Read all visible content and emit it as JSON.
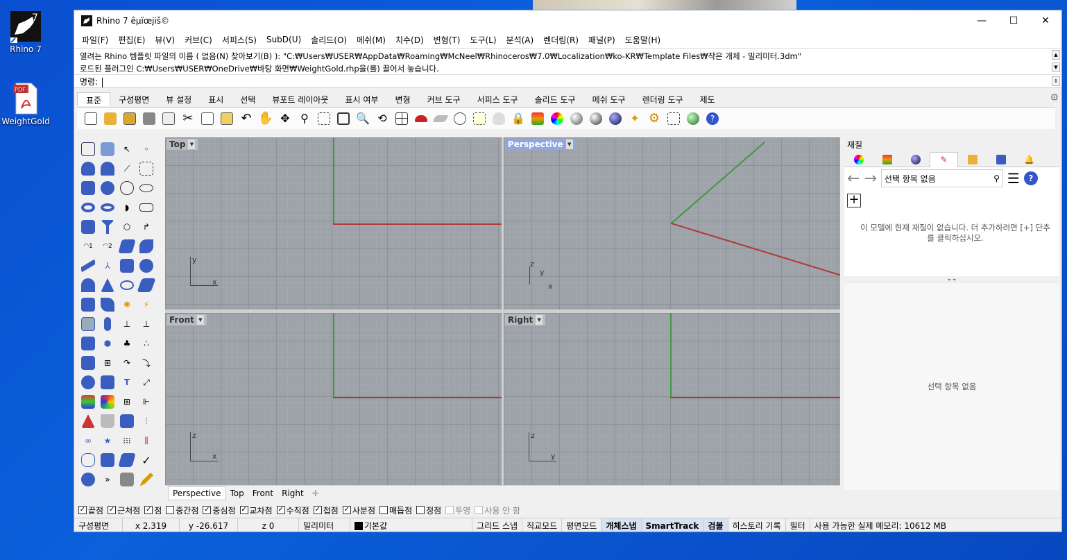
{
  "desktop": {
    "icons": [
      {
        "label": "Rhino 7"
      },
      {
        "label": "WeightGold"
      }
    ]
  },
  "window": {
    "title": "Rhino 7 êµïœjiš©",
    "controls": {
      "minimize": "—",
      "maximize": "☐",
      "close": "✕"
    }
  },
  "menubar": {
    "items": [
      "파일(F)",
      "편집(E)",
      "뷰(V)",
      "커브(C)",
      "서피스(S)",
      "SubD(U)",
      "솔리드(O)",
      "메쉬(M)",
      "치수(D)",
      "변형(T)",
      "도구(L)",
      "분석(A)",
      "렌더링(R)",
      "패널(P)",
      "도움말(H)"
    ]
  },
  "command": {
    "history": [
      "열려는 Rhino 템플릿 파일의 이름 ( 없음(N)  찾아보기(B) ): \"C:₩Users₩USER₩AppData₩Roaming₩McNeel₩Rhinoceros₩7.0₩Localization₩ko-KR₩Template Files₩작은 개체 - 밀리미터.3dm\"",
      "로드된 플러그인 C:₩Users₩USER₩OneDrive₩바탕 화면₩WeightGold.rhp을(를) 끌어서 놓습니다."
    ],
    "prompt": "명령:",
    "value": ""
  },
  "toolbar_tabs": [
    "표준",
    "구성평면",
    "뷰 설정",
    "표시",
    "선택",
    "뷰포트 레이아웃",
    "표시 여부",
    "변형",
    "커브 도구",
    "서피스 도구",
    "솔리드 도구",
    "메쉬 도구",
    "렌더링 도구",
    "제도"
  ],
  "viewports": {
    "top": {
      "label": "Top",
      "axis1": "y",
      "axis2": "x"
    },
    "perspective": {
      "label": "Perspective",
      "axis_z": "z",
      "axis_y": "y",
      "axis_x": "x"
    },
    "front": {
      "label": "Front",
      "axis1": "z",
      "axis2": "x"
    },
    "right": {
      "label": "Right",
      "axis1": "z",
      "axis2": "y"
    }
  },
  "viewport_tabs": [
    "Perspective",
    "Top",
    "Front",
    "Right"
  ],
  "panel": {
    "title": "재질",
    "search_value": "선택 항목 없음",
    "empty_message": "이 모델에 현재 재질이 없습니다. 더 추가하려면 [+] 단추를 클릭하십시오.",
    "props_message": "선택 항목 없음"
  },
  "osnap": [
    {
      "label": "끝점",
      "checked": true,
      "disabled": false
    },
    {
      "label": "근처점",
      "checked": true,
      "disabled": false
    },
    {
      "label": "점",
      "checked": true,
      "disabled": false
    },
    {
      "label": "중간점",
      "checked": false,
      "disabled": false
    },
    {
      "label": "중심점",
      "checked": true,
      "disabled": false
    },
    {
      "label": "교차점",
      "checked": true,
      "disabled": false
    },
    {
      "label": "수직점",
      "checked": true,
      "disabled": false
    },
    {
      "label": "접점",
      "checked": true,
      "disabled": false
    },
    {
      "label": "사분점",
      "checked": true,
      "disabled": false
    },
    {
      "label": "매듭점",
      "checked": false,
      "disabled": false
    },
    {
      "label": "정점",
      "checked": false,
      "disabled": false
    },
    {
      "label": "투영",
      "checked": false,
      "disabled": true
    },
    {
      "label": "사용 안 함",
      "checked": false,
      "disabled": true
    }
  ],
  "status": {
    "cplane": "구성평면",
    "x": "x 2.319",
    "y": "y -26.617",
    "z": "z 0",
    "units": "밀리미터",
    "layer": "기본값",
    "grid_snap": "그리드 스냅",
    "ortho": "직교모드",
    "planar": "평면모드",
    "osnap": "개체스냅",
    "smarttrack": "SmartTrack",
    "gumball": "검볼",
    "history": "히스토리 기록",
    "filter": "필터",
    "memory": "사용 가능한 실제 메모리: 10612 MB"
  }
}
